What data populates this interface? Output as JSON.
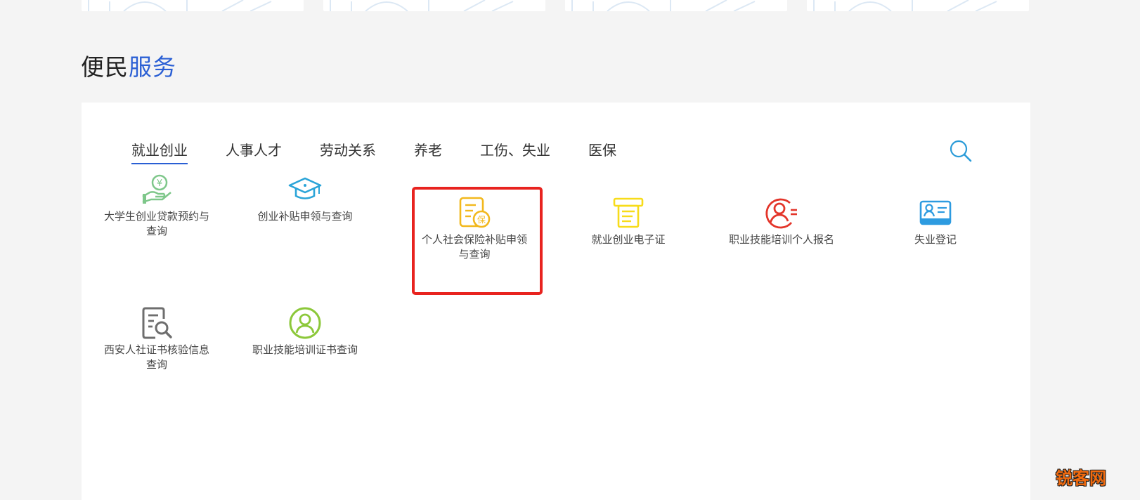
{
  "section": {
    "title_part1": "便民",
    "title_part2": "服务"
  },
  "tabs": [
    {
      "label": "就业创业",
      "active": true
    },
    {
      "label": "人事人才"
    },
    {
      "label": "劳动关系"
    },
    {
      "label": "养老"
    },
    {
      "label": "工伤、失业"
    },
    {
      "label": "医保"
    }
  ],
  "services": [
    {
      "label": "大学生创业贷款预约与查询",
      "icon": "yuan-hand-icon",
      "color": "#7ec78a"
    },
    {
      "label": "创业补贴申领与查询",
      "icon": "graduation-cap-icon",
      "color": "#2aa4d8"
    },
    {
      "label": "个人社会保险补贴申领与查询",
      "icon": "insurance-document-icon",
      "color": "#f2b81d",
      "badge": "保"
    },
    {
      "label": "就业创业电子证",
      "icon": "certificate-scroll-icon",
      "color": "#f7dc1a"
    },
    {
      "label": "职业技能培训个人报名",
      "icon": "person-form-icon",
      "color": "#e3352a"
    },
    {
      "label": "失业登记",
      "icon": "id-card-icon",
      "color": "#2d9be0"
    },
    {
      "label": "西安人社证书核验信息查询",
      "icon": "document-search-icon",
      "color": "#6e6e6e"
    },
    {
      "label": "职业技能培训证书查询",
      "icon": "person-circle-icon",
      "color": "#8cc83a"
    }
  ],
  "colors": {
    "accent": "#2a5fd4",
    "highlight_border": "#e8231f",
    "watermark": "#f06a0f"
  },
  "watermark": "锐客网"
}
